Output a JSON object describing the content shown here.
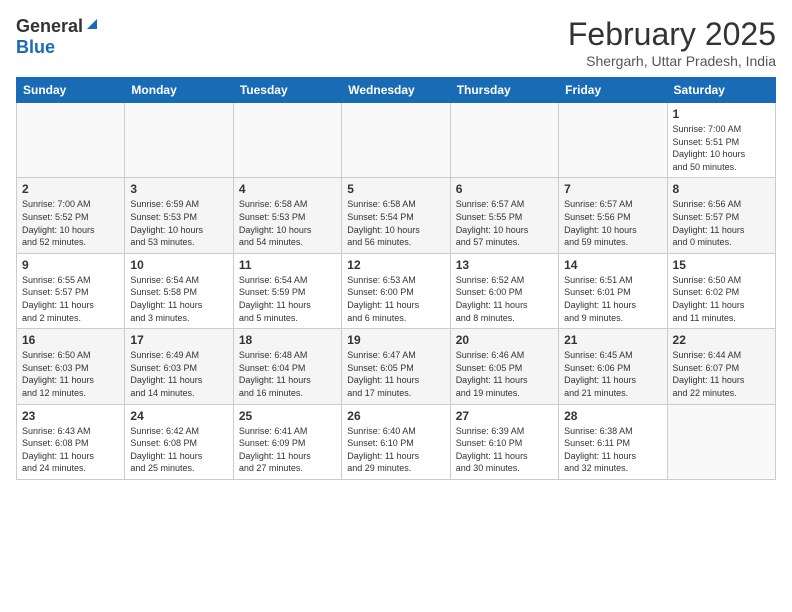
{
  "header": {
    "logo_general": "General",
    "logo_blue": "Blue",
    "title": "February 2025",
    "subtitle": "Shergarh, Uttar Pradesh, India"
  },
  "columns": [
    "Sunday",
    "Monday",
    "Tuesday",
    "Wednesday",
    "Thursday",
    "Friday",
    "Saturday"
  ],
  "weeks": [
    [
      {
        "day": "",
        "info": ""
      },
      {
        "day": "",
        "info": ""
      },
      {
        "day": "",
        "info": ""
      },
      {
        "day": "",
        "info": ""
      },
      {
        "day": "",
        "info": ""
      },
      {
        "day": "",
        "info": ""
      },
      {
        "day": "1",
        "info": "Sunrise: 7:00 AM\nSunset: 5:51 PM\nDaylight: 10 hours\nand 50 minutes."
      }
    ],
    [
      {
        "day": "2",
        "info": "Sunrise: 7:00 AM\nSunset: 5:52 PM\nDaylight: 10 hours\nand 52 minutes."
      },
      {
        "day": "3",
        "info": "Sunrise: 6:59 AM\nSunset: 5:53 PM\nDaylight: 10 hours\nand 53 minutes."
      },
      {
        "day": "4",
        "info": "Sunrise: 6:58 AM\nSunset: 5:53 PM\nDaylight: 10 hours\nand 54 minutes."
      },
      {
        "day": "5",
        "info": "Sunrise: 6:58 AM\nSunset: 5:54 PM\nDaylight: 10 hours\nand 56 minutes."
      },
      {
        "day": "6",
        "info": "Sunrise: 6:57 AM\nSunset: 5:55 PM\nDaylight: 10 hours\nand 57 minutes."
      },
      {
        "day": "7",
        "info": "Sunrise: 6:57 AM\nSunset: 5:56 PM\nDaylight: 10 hours\nand 59 minutes."
      },
      {
        "day": "8",
        "info": "Sunrise: 6:56 AM\nSunset: 5:57 PM\nDaylight: 11 hours\nand 0 minutes."
      }
    ],
    [
      {
        "day": "9",
        "info": "Sunrise: 6:55 AM\nSunset: 5:57 PM\nDaylight: 11 hours\nand 2 minutes."
      },
      {
        "day": "10",
        "info": "Sunrise: 6:54 AM\nSunset: 5:58 PM\nDaylight: 11 hours\nand 3 minutes."
      },
      {
        "day": "11",
        "info": "Sunrise: 6:54 AM\nSunset: 5:59 PM\nDaylight: 11 hours\nand 5 minutes."
      },
      {
        "day": "12",
        "info": "Sunrise: 6:53 AM\nSunset: 6:00 PM\nDaylight: 11 hours\nand 6 minutes."
      },
      {
        "day": "13",
        "info": "Sunrise: 6:52 AM\nSunset: 6:00 PM\nDaylight: 11 hours\nand 8 minutes."
      },
      {
        "day": "14",
        "info": "Sunrise: 6:51 AM\nSunset: 6:01 PM\nDaylight: 11 hours\nand 9 minutes."
      },
      {
        "day": "15",
        "info": "Sunrise: 6:50 AM\nSunset: 6:02 PM\nDaylight: 11 hours\nand 11 minutes."
      }
    ],
    [
      {
        "day": "16",
        "info": "Sunrise: 6:50 AM\nSunset: 6:03 PM\nDaylight: 11 hours\nand 12 minutes."
      },
      {
        "day": "17",
        "info": "Sunrise: 6:49 AM\nSunset: 6:03 PM\nDaylight: 11 hours\nand 14 minutes."
      },
      {
        "day": "18",
        "info": "Sunrise: 6:48 AM\nSunset: 6:04 PM\nDaylight: 11 hours\nand 16 minutes."
      },
      {
        "day": "19",
        "info": "Sunrise: 6:47 AM\nSunset: 6:05 PM\nDaylight: 11 hours\nand 17 minutes."
      },
      {
        "day": "20",
        "info": "Sunrise: 6:46 AM\nSunset: 6:05 PM\nDaylight: 11 hours\nand 19 minutes."
      },
      {
        "day": "21",
        "info": "Sunrise: 6:45 AM\nSunset: 6:06 PM\nDaylight: 11 hours\nand 21 minutes."
      },
      {
        "day": "22",
        "info": "Sunrise: 6:44 AM\nSunset: 6:07 PM\nDaylight: 11 hours\nand 22 minutes."
      }
    ],
    [
      {
        "day": "23",
        "info": "Sunrise: 6:43 AM\nSunset: 6:08 PM\nDaylight: 11 hours\nand 24 minutes."
      },
      {
        "day": "24",
        "info": "Sunrise: 6:42 AM\nSunset: 6:08 PM\nDaylight: 11 hours\nand 25 minutes."
      },
      {
        "day": "25",
        "info": "Sunrise: 6:41 AM\nSunset: 6:09 PM\nDaylight: 11 hours\nand 27 minutes."
      },
      {
        "day": "26",
        "info": "Sunrise: 6:40 AM\nSunset: 6:10 PM\nDaylight: 11 hours\nand 29 minutes."
      },
      {
        "day": "27",
        "info": "Sunrise: 6:39 AM\nSunset: 6:10 PM\nDaylight: 11 hours\nand 30 minutes."
      },
      {
        "day": "28",
        "info": "Sunrise: 6:38 AM\nSunset: 6:11 PM\nDaylight: 11 hours\nand 32 minutes."
      },
      {
        "day": "",
        "info": ""
      }
    ]
  ]
}
